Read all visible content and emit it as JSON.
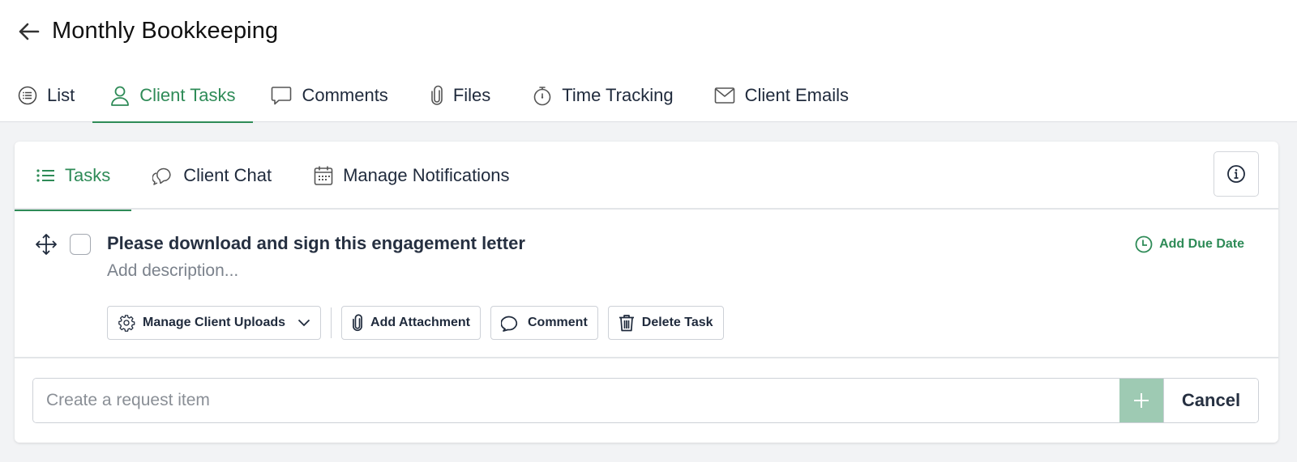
{
  "header": {
    "title": "Monthly Bookkeeping",
    "back_icon": "arrow-left-icon"
  },
  "main_tabs": [
    {
      "label": "List",
      "icon": "list-circle-icon",
      "active": false
    },
    {
      "label": "Client Tasks",
      "icon": "user-icon",
      "active": true
    },
    {
      "label": "Comments",
      "icon": "comment-icon",
      "active": false
    },
    {
      "label": "Files",
      "icon": "paperclip-icon",
      "active": false
    },
    {
      "label": "Time Tracking",
      "icon": "stopwatch-icon",
      "active": false
    },
    {
      "label": "Client Emails",
      "icon": "envelope-icon",
      "active": false
    }
  ],
  "sub_tabs": [
    {
      "label": "Tasks",
      "icon": "list-icon",
      "active": true
    },
    {
      "label": "Client Chat",
      "icon": "chat-bubbles-icon",
      "active": false
    },
    {
      "label": "Manage Notifications",
      "icon": "calendar-icon",
      "active": false
    }
  ],
  "info_button": {
    "icon": "info-icon"
  },
  "task": {
    "title": "Please download and sign this engagement letter",
    "description_placeholder": "Add description...",
    "due_date_label": "Add Due Date",
    "checked": false,
    "actions": {
      "manage_uploads": "Manage Client Uploads",
      "add_attachment": "Add Attachment",
      "comment": "Comment",
      "delete": "Delete Task"
    }
  },
  "create": {
    "placeholder": "Create a request item",
    "value": "",
    "add_label": "+",
    "cancel_label": "Cancel"
  },
  "colors": {
    "accent": "#2e8b57",
    "add_button": "#9ecab3",
    "text": "#1f2a3c",
    "background": "#f2f3f5"
  }
}
